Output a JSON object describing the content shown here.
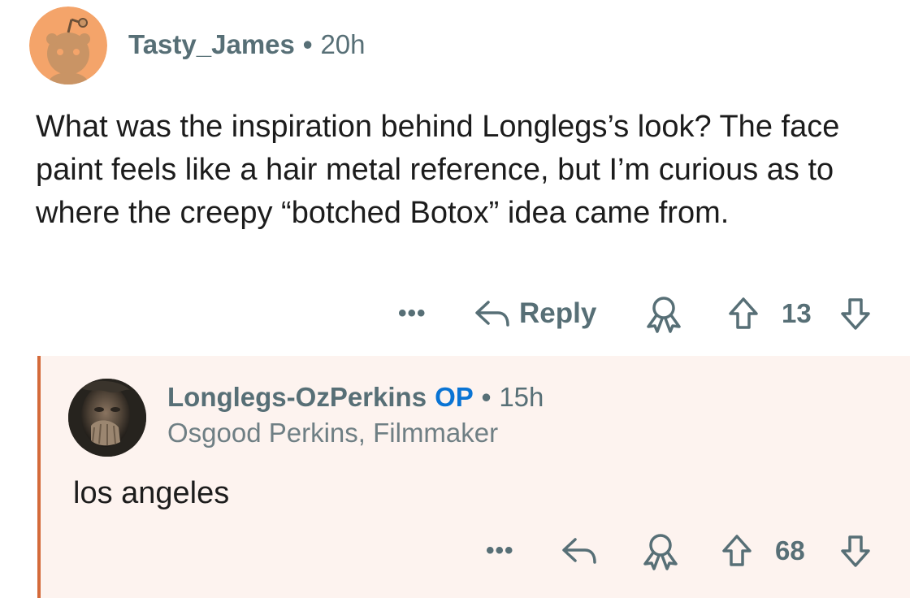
{
  "comment": {
    "username": "Tasty_James",
    "separator": "•",
    "timestamp": "20h",
    "body": "What was the inspiration behind Longlegs’s look? The face paint feels like a hair metal reference, but I’m curious as to where the creepy “botched Botox” idea came from.",
    "actions": {
      "more": "•••",
      "reply_label": "Reply",
      "vote_count": "13"
    }
  },
  "reply": {
    "username": "Longlegs-OzPerkins",
    "op_badge": "OP",
    "separator": "•",
    "timestamp": "15h",
    "flair": "Osgood Perkins, Filmmaker",
    "body": "los angeles",
    "actions": {
      "more": "•••",
      "vote_count": "68"
    }
  },
  "colors": {
    "meta_text": "#576f76",
    "op_blue": "#0a74d4",
    "thread_line": "#d46a3a",
    "reply_background": "#fdf3ef",
    "avatar_orange": "#f4a46a"
  },
  "icons": [
    "snoo-avatar",
    "reply-arrow-icon",
    "award-icon",
    "upvote-icon",
    "downvote-icon"
  ]
}
